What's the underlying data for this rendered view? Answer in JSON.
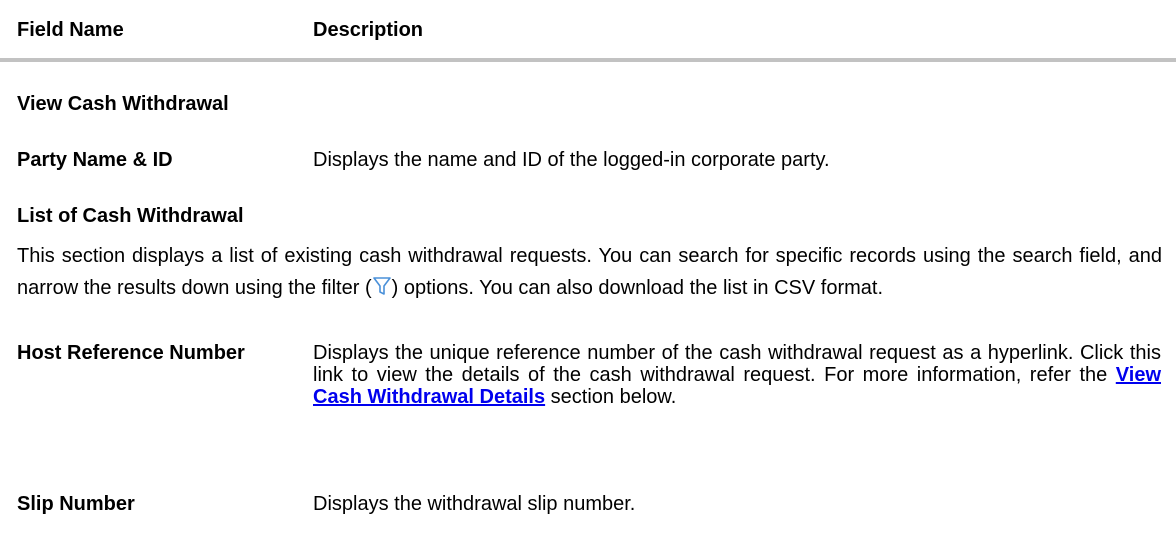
{
  "table_header": {
    "field_name": "Field Name",
    "description": "Description"
  },
  "view_cash_withdrawal": {
    "heading": "View Cash Withdrawal"
  },
  "party_name": {
    "label": "Party Name & ID",
    "description": "Displays the name and ID of the logged-in corporate party."
  },
  "list_section": {
    "heading": "List of Cash Withdrawal",
    "para_part1": "This section displays a list of existing cash withdrawal requests. You can search for specific records using the search field, and narrow the results down using the filter (",
    "para_part2": ") options. You can also download the list in CSV format.",
    "filter_icon": "filter-icon"
  },
  "host_ref": {
    "label": "Host Reference Number",
    "desc_part1": "Displays the unique reference number of the cash withdrawal request as a hyperlink. Click this link to view the details of the cash withdrawal request. For more information, refer the ",
    "link_text": "View Cash Withdrawal Details",
    "desc_part2": " section below."
  },
  "slip_number": {
    "label": "Slip Number",
    "description": "Displays the withdrawal slip number."
  },
  "colors": {
    "link": "#0000ee",
    "divider": "#c2c2c2",
    "icon": "#4a90d9"
  }
}
